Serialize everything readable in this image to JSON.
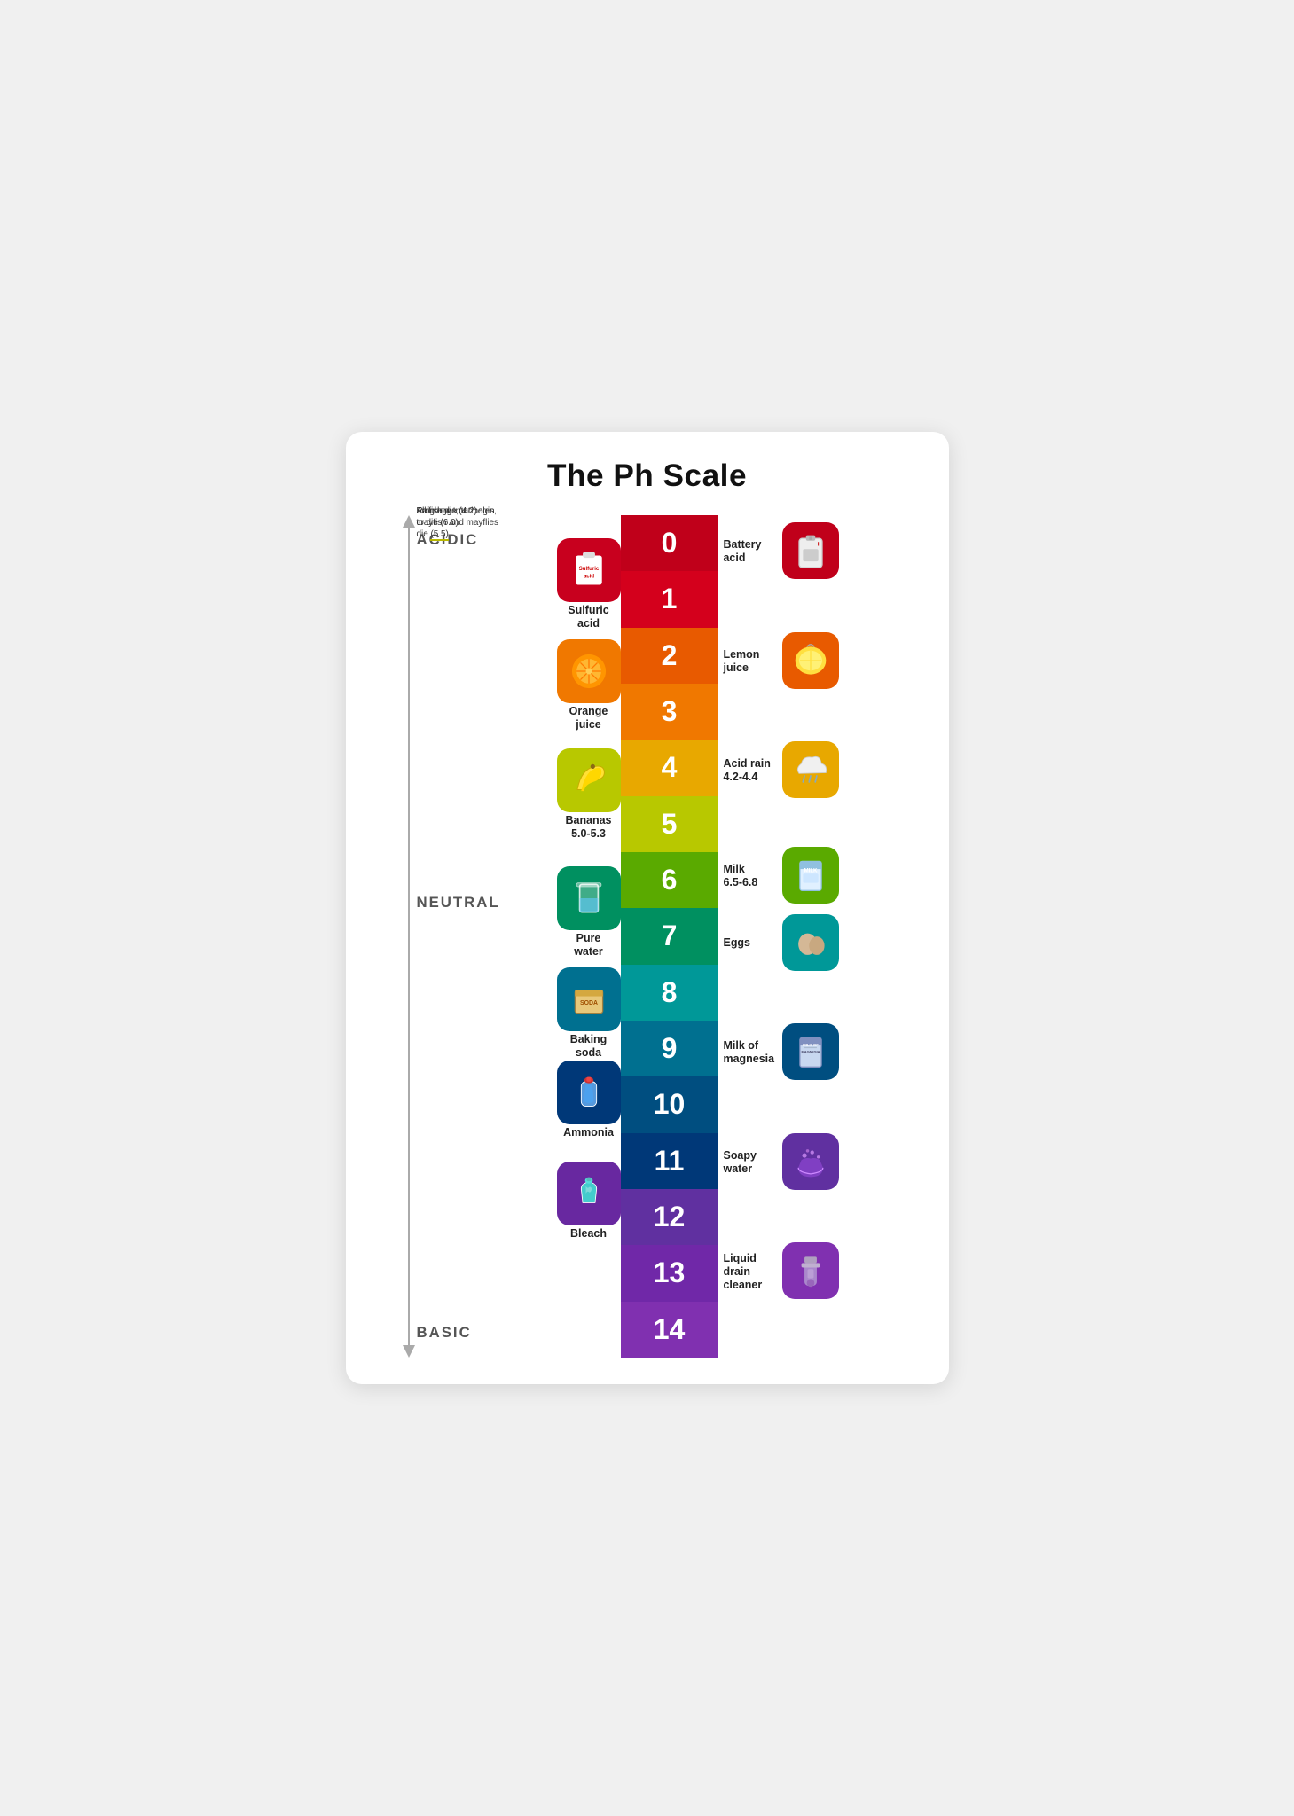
{
  "title": "The Ph Scale",
  "axis": {
    "acidic": "ACIDIC",
    "neutral": "NEUTRAL",
    "basic": "BASIC"
  },
  "notes": [
    {
      "text": "All fish die (4.2)",
      "top_pct": 30.5
    },
    {
      "text_parts": [
        "Frog eggs, tadpoles, crayfish and mayflies die ",
        "(5.5)"
      ],
      "top_pct": 35.5,
      "underline_last": true
    },
    {
      "text": "Rainbow trout begin to die (6.0)",
      "top_pct": 42.5
    }
  ],
  "scale": [
    {
      "value": 0,
      "color": "#c0001a"
    },
    {
      "value": 1,
      "color": "#d9001e"
    },
    {
      "value": 2,
      "color": "#e85a00"
    },
    {
      "value": 3,
      "color": "#f07800"
    },
    {
      "value": 4,
      "color": "#e8a800"
    },
    {
      "value": 5,
      "color": "#b8c800"
    },
    {
      "value": 6,
      "color": "#5aaa00"
    },
    {
      "value": 7,
      "color": "#009060"
    },
    {
      "value": 8,
      "color": "#009898"
    },
    {
      "value": 9,
      "color": "#007090"
    },
    {
      "value": 10,
      "color": "#004e80"
    },
    {
      "value": 11,
      "color": "#003878"
    },
    {
      "value": 12,
      "color": "#6030a0"
    },
    {
      "value": 13,
      "color": "#7028a8"
    },
    {
      "value": 14,
      "color": "#8030b0"
    }
  ],
  "left_items": [
    {
      "label": "Sulfuric acid",
      "emoji": "🧪",
      "bg": "#c8001e",
      "top_pct": 6.5
    },
    {
      "label": "Orange juice",
      "emoji": "🍊",
      "bg": "#f07800",
      "top_pct": 18.5
    },
    {
      "label": "Bananas 5.0-5.3",
      "emoji": "🍌",
      "bg": "#b8c800",
      "top_pct": 31.5
    },
    {
      "label": "Pure water",
      "emoji": "🥛",
      "bg": "#009060",
      "top_pct": 45.5
    },
    {
      "label": "Baking soda",
      "emoji": "📦",
      "bg": "#007090",
      "top_pct": 57.5
    },
    {
      "label": "Ammonia",
      "emoji": "🧴",
      "bg": "#003878",
      "top_pct": 68.5
    },
    {
      "label": "Bleach",
      "emoji": "🧴",
      "bg": "#6828a0",
      "top_pct": 80.5
    }
  ],
  "right_items": [
    {
      "label": "Battery acid",
      "emoji": "🔋",
      "bg": "#c0001a",
      "top_pct": 0
    },
    {
      "label": "Lemon juice",
      "emoji": "🍋",
      "bg": "#e85a00",
      "top_pct": 13
    },
    {
      "label": "Acid rain 4.2-4.4",
      "emoji": "🌧",
      "bg": "#e8a800",
      "top_pct": 26
    },
    {
      "label": "Milk 6.5-6.8",
      "emoji": "🥛",
      "bg": "#5aaa00",
      "top_pct": 38.5
    },
    {
      "label": "Eggs",
      "emoji": "🥚",
      "bg": "#009898",
      "top_pct": 46.5
    },
    {
      "label": "Milk of magnesia",
      "emoji": "💊",
      "bg": "#004e80",
      "top_pct": 59.5
    },
    {
      "label": "Soapy water",
      "emoji": "🛁",
      "bg": "#6030a0",
      "top_pct": 72.5
    },
    {
      "label": "Liquid drain cleaner",
      "emoji": "🪠",
      "bg": "#8030b0",
      "top_pct": 85.5
    }
  ]
}
